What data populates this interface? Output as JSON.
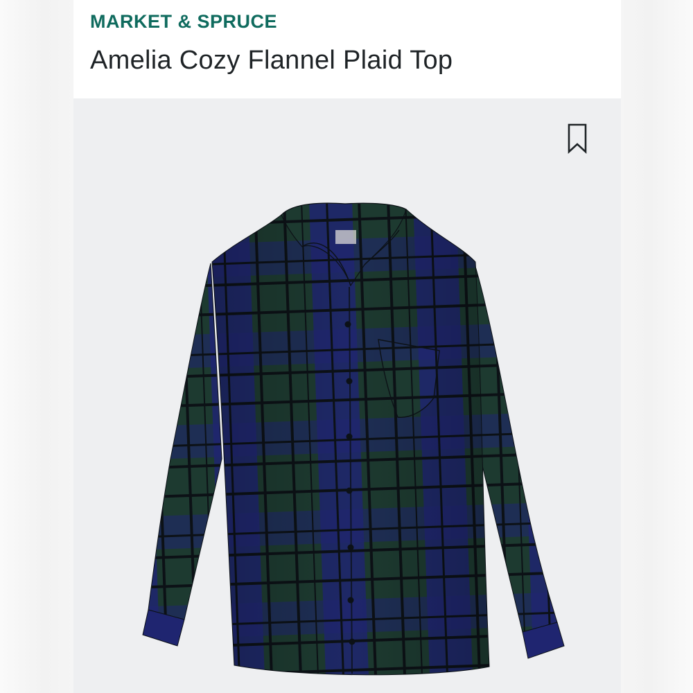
{
  "product": {
    "brand": "MARKET & SPRUCE",
    "title": "Amelia Cozy Flannel Plaid Top"
  },
  "image": {
    "subject": "shirt-photo",
    "bookmark_icon": "bookmark-icon"
  },
  "colors": {
    "brand": "#0f6b5e",
    "title": "#1e2326",
    "photo_background": "#eeeff1",
    "plaid_green": "#1d3a30",
    "plaid_navy": "#1f2570",
    "plaid_black": "#0c1116"
  }
}
